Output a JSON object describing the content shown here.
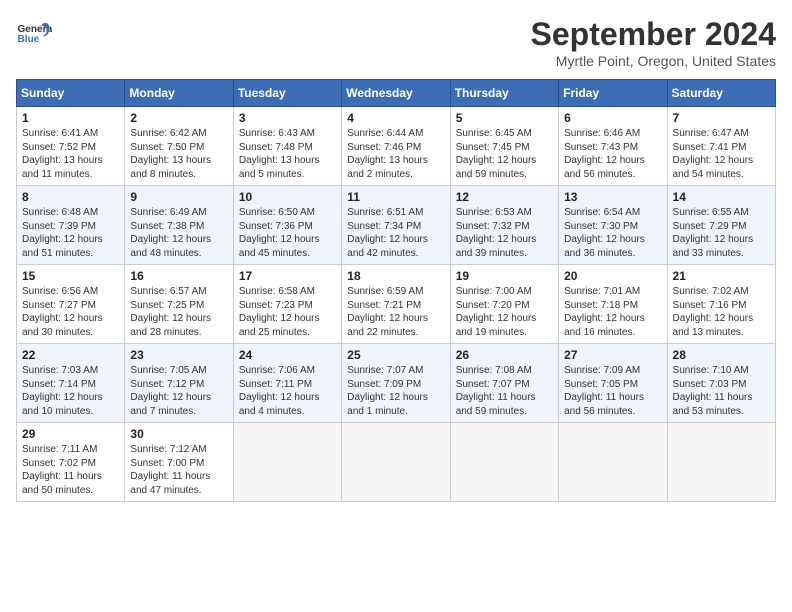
{
  "header": {
    "logo_line1": "General",
    "logo_line2": "Blue",
    "month": "September 2024",
    "location": "Myrtle Point, Oregon, United States"
  },
  "weekdays": [
    "Sunday",
    "Monday",
    "Tuesday",
    "Wednesday",
    "Thursday",
    "Friday",
    "Saturday"
  ],
  "weeks": [
    [
      {
        "day": 1,
        "sunrise": "6:41 AM",
        "sunset": "7:52 PM",
        "daylight": "13 hours and 11 minutes."
      },
      {
        "day": 2,
        "sunrise": "6:42 AM",
        "sunset": "7:50 PM",
        "daylight": "13 hours and 8 minutes."
      },
      {
        "day": 3,
        "sunrise": "6:43 AM",
        "sunset": "7:48 PM",
        "daylight": "13 hours and 5 minutes."
      },
      {
        "day": 4,
        "sunrise": "6:44 AM",
        "sunset": "7:46 PM",
        "daylight": "13 hours and 2 minutes."
      },
      {
        "day": 5,
        "sunrise": "6:45 AM",
        "sunset": "7:45 PM",
        "daylight": "12 hours and 59 minutes."
      },
      {
        "day": 6,
        "sunrise": "6:46 AM",
        "sunset": "7:43 PM",
        "daylight": "12 hours and 56 minutes."
      },
      {
        "day": 7,
        "sunrise": "6:47 AM",
        "sunset": "7:41 PM",
        "daylight": "12 hours and 54 minutes."
      }
    ],
    [
      {
        "day": 8,
        "sunrise": "6:48 AM",
        "sunset": "7:39 PM",
        "daylight": "12 hours and 51 minutes."
      },
      {
        "day": 9,
        "sunrise": "6:49 AM",
        "sunset": "7:38 PM",
        "daylight": "12 hours and 48 minutes."
      },
      {
        "day": 10,
        "sunrise": "6:50 AM",
        "sunset": "7:36 PM",
        "daylight": "12 hours and 45 minutes."
      },
      {
        "day": 11,
        "sunrise": "6:51 AM",
        "sunset": "7:34 PM",
        "daylight": "12 hours and 42 minutes."
      },
      {
        "day": 12,
        "sunrise": "6:53 AM",
        "sunset": "7:32 PM",
        "daylight": "12 hours and 39 minutes."
      },
      {
        "day": 13,
        "sunrise": "6:54 AM",
        "sunset": "7:30 PM",
        "daylight": "12 hours and 36 minutes."
      },
      {
        "day": 14,
        "sunrise": "6:55 AM",
        "sunset": "7:29 PM",
        "daylight": "12 hours and 33 minutes."
      }
    ],
    [
      {
        "day": 15,
        "sunrise": "6:56 AM",
        "sunset": "7:27 PM",
        "daylight": "12 hours and 30 minutes."
      },
      {
        "day": 16,
        "sunrise": "6:57 AM",
        "sunset": "7:25 PM",
        "daylight": "12 hours and 28 minutes."
      },
      {
        "day": 17,
        "sunrise": "6:58 AM",
        "sunset": "7:23 PM",
        "daylight": "12 hours and 25 minutes."
      },
      {
        "day": 18,
        "sunrise": "6:59 AM",
        "sunset": "7:21 PM",
        "daylight": "12 hours and 22 minutes."
      },
      {
        "day": 19,
        "sunrise": "7:00 AM",
        "sunset": "7:20 PM",
        "daylight": "12 hours and 19 minutes."
      },
      {
        "day": 20,
        "sunrise": "7:01 AM",
        "sunset": "7:18 PM",
        "daylight": "12 hours and 16 minutes."
      },
      {
        "day": 21,
        "sunrise": "7:02 AM",
        "sunset": "7:16 PM",
        "daylight": "12 hours and 13 minutes."
      }
    ],
    [
      {
        "day": 22,
        "sunrise": "7:03 AM",
        "sunset": "7:14 PM",
        "daylight": "12 hours and 10 minutes."
      },
      {
        "day": 23,
        "sunrise": "7:05 AM",
        "sunset": "7:12 PM",
        "daylight": "12 hours and 7 minutes."
      },
      {
        "day": 24,
        "sunrise": "7:06 AM",
        "sunset": "7:11 PM",
        "daylight": "12 hours and 4 minutes."
      },
      {
        "day": 25,
        "sunrise": "7:07 AM",
        "sunset": "7:09 PM",
        "daylight": "12 hours and 1 minute."
      },
      {
        "day": 26,
        "sunrise": "7:08 AM",
        "sunset": "7:07 PM",
        "daylight": "11 hours and 59 minutes."
      },
      {
        "day": 27,
        "sunrise": "7:09 AM",
        "sunset": "7:05 PM",
        "daylight": "11 hours and 56 minutes."
      },
      {
        "day": 28,
        "sunrise": "7:10 AM",
        "sunset": "7:03 PM",
        "daylight": "11 hours and 53 minutes."
      }
    ],
    [
      {
        "day": 29,
        "sunrise": "7:11 AM",
        "sunset": "7:02 PM",
        "daylight": "11 hours and 50 minutes."
      },
      {
        "day": 30,
        "sunrise": "7:12 AM",
        "sunset": "7:00 PM",
        "daylight": "11 hours and 47 minutes."
      },
      null,
      null,
      null,
      null,
      null
    ]
  ],
  "labels": {
    "sunrise": "Sunrise:",
    "sunset": "Sunset:",
    "daylight": "Daylight:"
  }
}
